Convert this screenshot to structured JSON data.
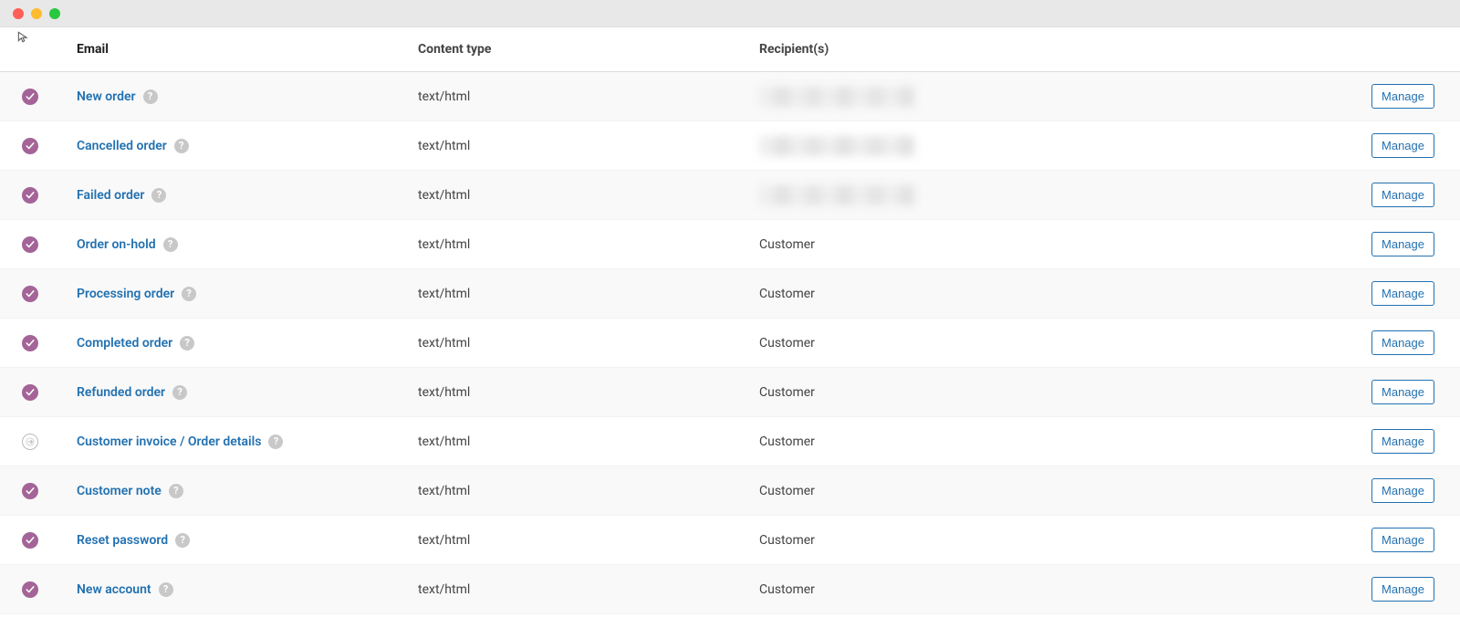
{
  "window": {
    "os": "mac"
  },
  "headers": {
    "status": "",
    "email": "Email",
    "content": "Content type",
    "recipient": "Recipient(s)",
    "action": ""
  },
  "labels": {
    "manage": "Manage"
  },
  "rows": [
    {
      "status": "on",
      "name": "New order",
      "content": "text/html",
      "recipient": "",
      "redacted": true
    },
    {
      "status": "on",
      "name": "Cancelled order",
      "content": "text/html",
      "recipient": "",
      "redacted": true
    },
    {
      "status": "on",
      "name": "Failed order",
      "content": "text/html",
      "recipient": "",
      "redacted": true
    },
    {
      "status": "on",
      "name": "Order on-hold",
      "content": "text/html",
      "recipient": "Customer",
      "redacted": false
    },
    {
      "status": "on",
      "name": "Processing order",
      "content": "text/html",
      "recipient": "Customer",
      "redacted": false
    },
    {
      "status": "on",
      "name": "Completed order",
      "content": "text/html",
      "recipient": "Customer",
      "redacted": false
    },
    {
      "status": "on",
      "name": "Refunded order",
      "content": "text/html",
      "recipient": "Customer",
      "redacted": false
    },
    {
      "status": "manual",
      "name": "Customer invoice / Order details",
      "content": "text/html",
      "recipient": "Customer",
      "redacted": false
    },
    {
      "status": "on",
      "name": "Customer note",
      "content": "text/html",
      "recipient": "Customer",
      "redacted": false
    },
    {
      "status": "on",
      "name": "Reset password",
      "content": "text/html",
      "recipient": "Customer",
      "redacted": false
    },
    {
      "status": "on",
      "name": "New account",
      "content": "text/html",
      "recipient": "Customer",
      "redacted": false
    }
  ]
}
